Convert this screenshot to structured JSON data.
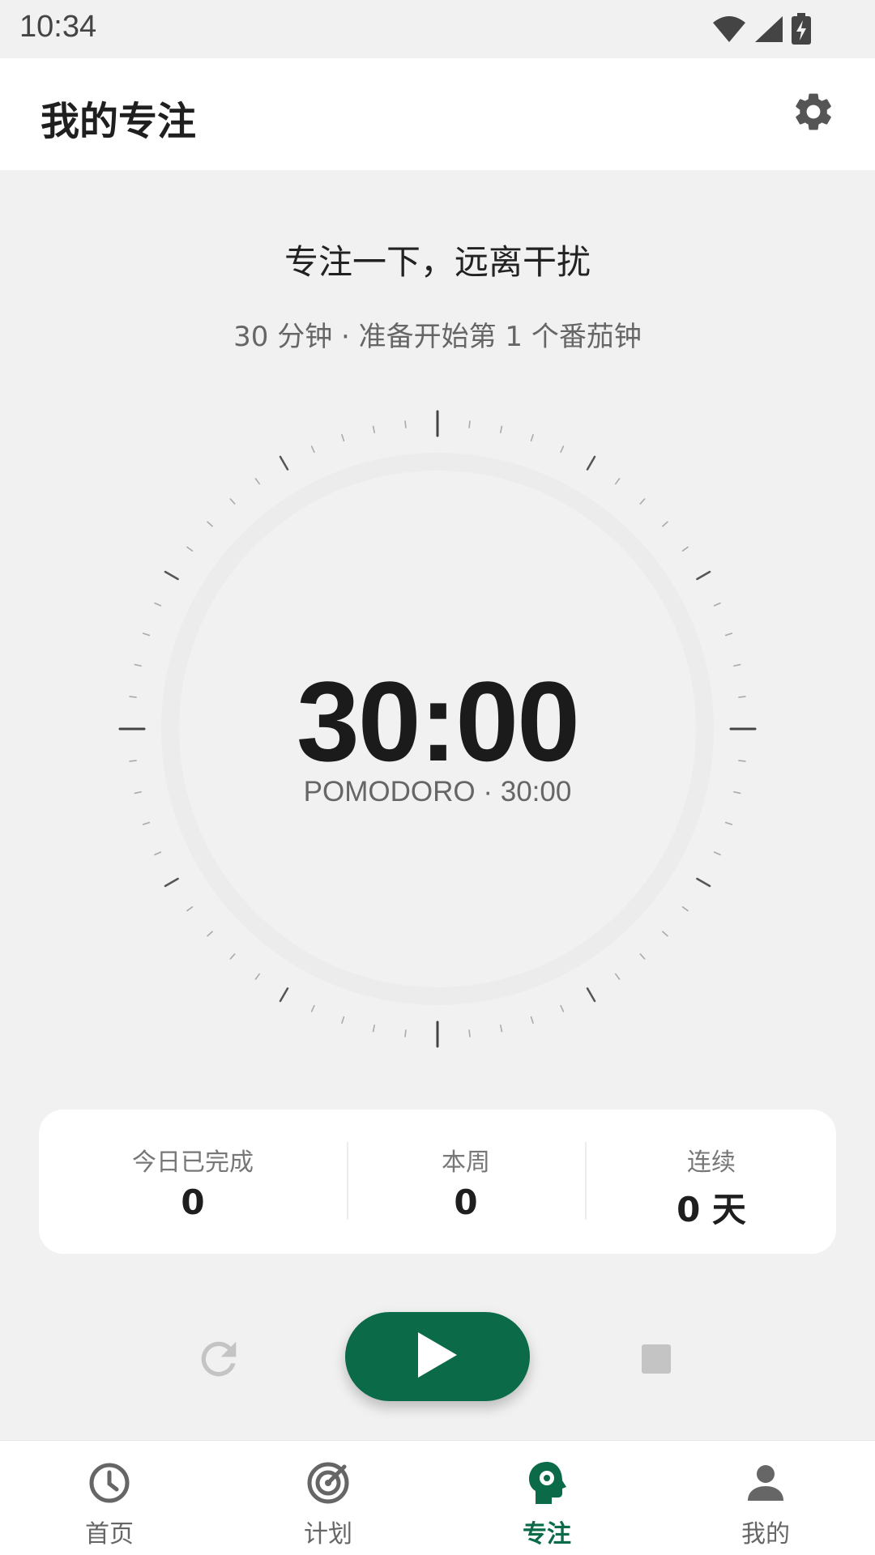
{
  "status_bar": {
    "time": "10:34",
    "icons": [
      "wifi-icon",
      "signal-icon",
      "battery-charging-icon"
    ]
  },
  "app_bar": {
    "title": "我的专注",
    "settings_icon": "gear-icon"
  },
  "focus": {
    "headline": "专注一下，远离干扰",
    "subline": "30 分钟 · 准备开始第 1 个番茄钟",
    "timer": "30:00",
    "timer_sub": "POMODORO · 30:00"
  },
  "stats": [
    {
      "label": "今日已完成",
      "value": "0"
    },
    {
      "label": "本周",
      "value": "0"
    },
    {
      "label": "连续",
      "value": "0 天"
    }
  ],
  "controls": {
    "reset_icon": "refresh-icon",
    "play_icon": "play-icon",
    "stop_icon": "stop-icon"
  },
  "bottom_nav": [
    {
      "label": "首页",
      "icon": "clock-icon",
      "active": false
    },
    {
      "label": "计划",
      "icon": "target-icon",
      "active": false
    },
    {
      "label": "专注",
      "icon": "brain-gear-icon",
      "active": true
    },
    {
      "label": "我的",
      "icon": "person-icon",
      "active": false
    }
  ],
  "colors": {
    "accent": "#0b6b49",
    "background": "#f1f1f1",
    "card": "#ffffff"
  }
}
